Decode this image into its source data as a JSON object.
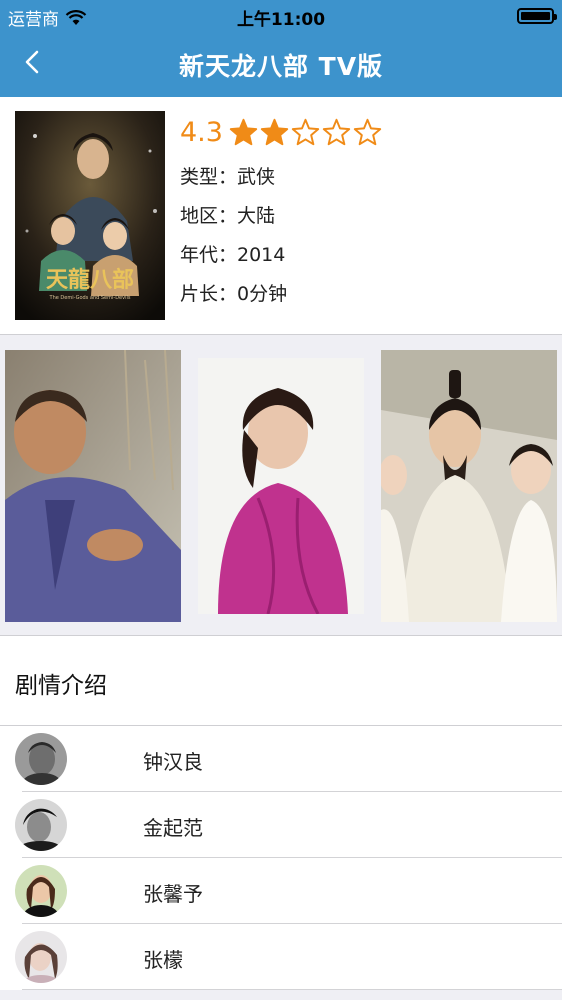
{
  "status_bar": {
    "carrier": "运营商",
    "time": "上午11:00"
  },
  "nav": {
    "title": "新天龙八部 TV版"
  },
  "movie": {
    "rating": "4.3",
    "stars": {
      "filled": 2,
      "total": 5
    },
    "genre": "类型：武侠",
    "region": "地区：大陆",
    "year": "年代：2014",
    "duration": "片长：0分钟",
    "poster_text": {
      "title_art": "天龍八部",
      "subtitle": "The Demi-Gods and Semi-Devils"
    }
  },
  "synopsis": {
    "title": "剧情介绍"
  },
  "cast": [
    {
      "name": "钟汉良"
    },
    {
      "name": "金起范"
    },
    {
      "name": "张馨予"
    },
    {
      "name": "张檬"
    }
  ],
  "colors": {
    "nav_bar": "#3d93cc",
    "rating": "#f08b17",
    "background": "#efeff4"
  }
}
